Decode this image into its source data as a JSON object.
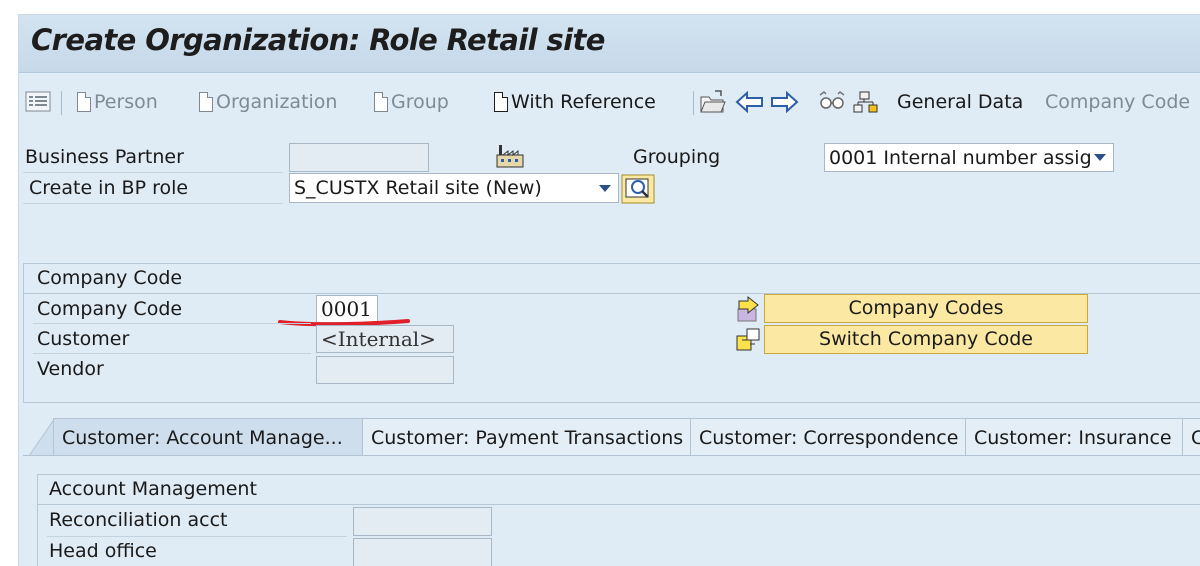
{
  "window": {
    "title": "Create Organization: Role Retail site"
  },
  "toolbar": {
    "person": "Person",
    "organization": "Organization",
    "group": "Group",
    "with_reference": "With Reference",
    "general_data": "General Data",
    "company_code": "Company Code"
  },
  "header": {
    "business_partner_label": "Business Partner",
    "business_partner_value": "",
    "create_in_role_label": "Create in BP role",
    "create_in_role_value": "S_CUSTX Retail site (New)",
    "grouping_label": "Grouping",
    "grouping_value": "0001 Internal number assig"
  },
  "company_code_section": {
    "title": "Company Code",
    "company_code_label": "Company Code",
    "company_code_value": "0001",
    "customer_label": "Customer",
    "customer_value": "<Internal>",
    "vendor_label": "Vendor",
    "vendor_value": "",
    "company_codes_button": "Company Codes",
    "switch_company_code_button": "Switch Company Code",
    "annotation_color": "#e0202a"
  },
  "tabs": [
    {
      "label": "Customer: Account Manage...",
      "active": true
    },
    {
      "label": "Customer: Payment Transactions",
      "active": false
    },
    {
      "label": "Customer: Correspondence",
      "active": false
    },
    {
      "label": "Customer: Insurance",
      "active": false
    },
    {
      "label": "C",
      "active": false
    }
  ],
  "account_management": {
    "title": "Account Management",
    "reconciliation_label": "Reconciliation acct",
    "reconciliation_value": "",
    "head_office_label": "Head office",
    "head_office_value": ""
  },
  "colors": {
    "background": "#dfebf5",
    "title_bar": "#c9dced",
    "button_yellow": "#fbe8a2",
    "dropdown_arrow": "#2b4f86"
  }
}
